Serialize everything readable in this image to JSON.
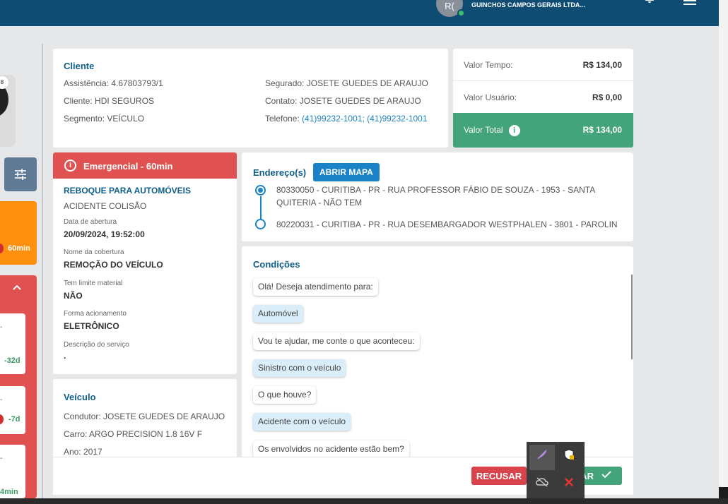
{
  "header": {
    "avatar_initials": "R(",
    "company": "GUINCHOS CAMPOS GERAIS LTDA...",
    "bell_icon": "bell-icon",
    "menu_icon": "hamburger-menu-icon"
  },
  "sidebar": {
    "badge": "8",
    "filter_icon": "sliders-icon",
    "orange_card_time": "60min",
    "cards": [
      {
        "time": "-32d"
      },
      {
        "time": "-7d"
      },
      {
        "time": "4min"
      }
    ]
  },
  "cliente": {
    "title": "Cliente",
    "assistencia_label": "Assistência:",
    "assistencia": "4.67803793/1",
    "cliente_label": "Cliente:",
    "cliente": "HDI SEGUROS",
    "segmento_label": "Segmento:",
    "segmento": "VEÍCULO",
    "segurado_label": "Segurado:",
    "segurado": "JOSETE GUEDES DE ARAUJO",
    "contato_label": "Contato:",
    "contato": "JOSETE GUEDES DE ARAUJO",
    "telefone_label": "Telefone:",
    "telefone": "(41)99232-1001; (41)99232-1001"
  },
  "valores": {
    "tempo_label": "Valor Tempo:",
    "tempo": "R$ 134,00",
    "usuario_label": "Valor Usuário:",
    "usuario": "R$ 0,00",
    "total_label": "Valor Total",
    "total": "R$ 134,00"
  },
  "servico": {
    "header": "Emergencial - 60min",
    "tipo": "REBOQUE PARA AUTOMÓVEIS",
    "motivo": "ACIDENTE COLISÃO",
    "data_label": "Data de abertura",
    "data": "20/09/2024, 19:52:00",
    "cobertura_label": "Nome da cobertura",
    "cobertura": "REMOÇÃO DO VEÍCULO",
    "limite_label": "Tem limite material",
    "limite": "NÃO",
    "acionamento_label": "Forma acionamento",
    "acionamento": "ELETRÔNICO",
    "descricao_label": "Descrição do serviço",
    "descricao": "."
  },
  "veiculo": {
    "title": "Veículo",
    "condutor_label": "Condutor:",
    "condutor": "JOSETE GUEDES DE ARAUJO",
    "carro_label": "Carro:",
    "carro": "ARGO PRECISION 1.8 16V F",
    "ano_label": "Ano:",
    "ano": "2017"
  },
  "endereco": {
    "title": "Endereço(s)",
    "map_button": "ABRIR MAPA",
    "origem": "80330050 - CURITIBA - PR - RUA PROFESSOR FÁBIO DE SOUZA - 1953 - SANTA QUITERIA - NÃO TEM",
    "destino": "80220031 - CURITIBA - PR - RUA DESEMBARGADOR WESTPHALEN - 3801 - PAROLIN"
  },
  "condicoes": {
    "title": "Condições",
    "messages": [
      "Olá! Deseja atendimento para:",
      "Automóvel",
      "Vou te ajudar, me conte o que aconteceu:",
      "Sinistro com o veículo",
      "O que houve?",
      "Acidente com o veículo",
      "Os envolvidos no acidente estão bem?"
    ]
  },
  "actions": {
    "recusar": "RECUSAR",
    "aceitar": "AR"
  }
}
